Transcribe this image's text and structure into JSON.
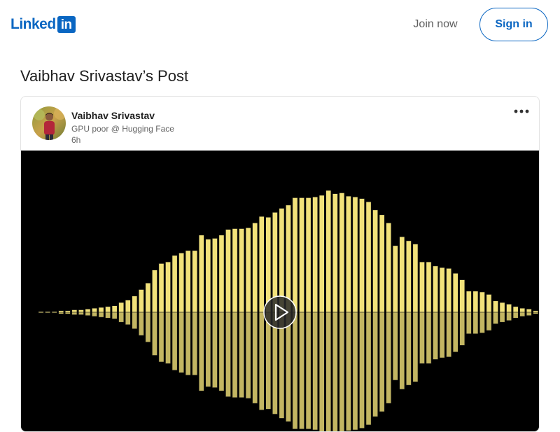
{
  "header": {
    "logo_word": "Linked",
    "logo_box": "in",
    "join_label": "Join now",
    "signin_label": "Sign in",
    "brand_color": "#0a66c2"
  },
  "page": {
    "title": "Vaibhav Srivastav’s Post"
  },
  "post": {
    "author_name": "Vaibhav Srivastav",
    "author_headline": "GPU poor @ Hugging Face",
    "time": "6h",
    "more_icon": "ellipsis-icon",
    "video": {
      "play_icon": "play-icon",
      "waveform_color": "#f2e27a",
      "levels": [
        0.01,
        0.01,
        0.01,
        0.02,
        0.02,
        0.03,
        0.03,
        0.04,
        0.05,
        0.06,
        0.07,
        0.08,
        0.12,
        0.15,
        0.2,
        0.28,
        0.36,
        0.52,
        0.6,
        0.62,
        0.7,
        0.73,
        0.76,
        0.76,
        0.95,
        0.9,
        0.91,
        0.95,
        1.02,
        1.03,
        1.03,
        1.04,
        1.1,
        1.18,
        1.17,
        1.23,
        1.28,
        1.32,
        1.41,
        1.41,
        1.41,
        1.42,
        1.44,
        1.5,
        1.46,
        1.47,
        1.43,
        1.42,
        1.4,
        1.36,
        1.26,
        1.2,
        1.1,
        0.82,
        0.93,
        0.88,
        0.84,
        0.62,
        0.62,
        0.57,
        0.55,
        0.54,
        0.48,
        0.4,
        0.26,
        0.26,
        0.25,
        0.22,
        0.14,
        0.12,
        0.1,
        0.07,
        0.05,
        0.04,
        0.02
      ]
    }
  }
}
